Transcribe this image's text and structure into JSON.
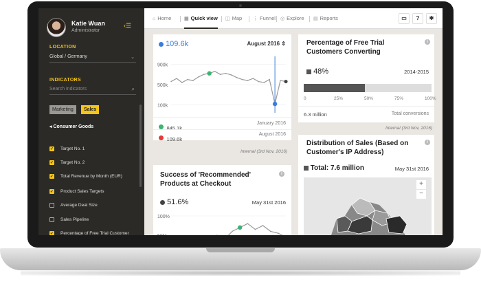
{
  "sidebar": {
    "user_name": "Katie Wuan",
    "user_role": "Administrator",
    "location_heading": "LOCATION",
    "location_value": "Global / Germany",
    "indicators_heading": "INDICATORS",
    "search_placeholder": "Search indicators",
    "tabs": [
      "Marketing",
      "Sales"
    ],
    "active_tab": "Sales",
    "group_title": "Consumer Goods",
    "indicators": [
      {
        "label": "Target No. 1",
        "checked": true
      },
      {
        "label": "Target No. 2",
        "checked": true
      },
      {
        "label": "Total Revenue by Month (EUR)",
        "checked": true
      },
      {
        "label": "Product Sales Targets",
        "checked": true
      },
      {
        "label": "Average Deal Size",
        "checked": false
      },
      {
        "label": "Sales Pipeline",
        "checked": false
      },
      {
        "label": "Percentage of Free Trial Customer Converting",
        "checked": true
      }
    ]
  },
  "nav": {
    "items": [
      {
        "label": "Home",
        "icon": "home-icon",
        "glyph": "⌂"
      },
      {
        "label": "Quick view",
        "icon": "grid-icon",
        "glyph": "▦"
      },
      {
        "label": "Map",
        "icon": "map-icon",
        "glyph": "◫"
      },
      {
        "label": "Funnel",
        "icon": "funnel-icon",
        "glyph": "⋮"
      },
      {
        "label": "Explore",
        "icon": "explore-icon",
        "glyph": "◎"
      },
      {
        "label": "Reports",
        "icon": "report-icon",
        "glyph": "▤"
      }
    ],
    "active": "Quick view",
    "right_buttons": {
      "help": "?"
    }
  },
  "line_card": {
    "value": "109.6k",
    "date_select": "August 2016",
    "y_ticks": [
      "900k",
      "500k",
      "100k"
    ],
    "legend": [
      {
        "color": "#3cb371",
        "value": "845.1k",
        "date": "January 2016"
      },
      {
        "color": "#e53935",
        "value": "109.6k",
        "date": "August 2016"
      }
    ],
    "caption": "Internal (3rd Nov, 2016)"
  },
  "recommended_card": {
    "title": "Success of 'Recommended' Products at Checkout",
    "value": "51.6%",
    "date": "May 31st 2016",
    "y_ticks": [
      "100%",
      "50%"
    ]
  },
  "trial_card": {
    "title": "Percentage of Free Trial Customers Converting",
    "value": "48%",
    "range": "2014-2015",
    "progress": 0.48,
    "ticks": [
      "0",
      "25%",
      "50%",
      "75%",
      "100%"
    ],
    "total": "6.3 million",
    "total_label": "Total conversions",
    "caption": "Internal (3rd Nov, 2016)"
  },
  "sales_card": {
    "title": "Distribution of Sales (Based on Customer's IP Address)",
    "total": "Total: 7.6 million",
    "date": "May 31st 2016",
    "zoom_in": "+",
    "zoom_out": "−"
  },
  "chart_data": [
    {
      "type": "line",
      "ylim": [
        0,
        1000
      ],
      "y_ticks": [
        "900k",
        "500k",
        "100k"
      ],
      "values": [
        560,
        620,
        540,
        600,
        580,
        650,
        700,
        720,
        760,
        700,
        720,
        690,
        640,
        600,
        580,
        620,
        560,
        540,
        600,
        120,
        580,
        560
      ],
      "highlights": [
        {
          "index": 7,
          "color": "#3cb371"
        },
        {
          "index": 19,
          "color": "#3b7ddd"
        }
      ],
      "value_unit": "k"
    },
    {
      "type": "line",
      "ylim": [
        0,
        100
      ],
      "y_ticks": [
        "100%",
        "50%"
      ],
      "values": [
        20,
        30,
        45,
        15,
        35,
        30,
        50,
        40,
        60,
        70,
        80,
        65,
        75,
        60,
        55,
        45
      ],
      "highlights": [
        {
          "index": 9,
          "color": "#3cb371"
        }
      ]
    }
  ],
  "colors": {
    "accent": "#f4c51a",
    "sidebar": "#2b2a27",
    "blue": "#3b7ddd",
    "green": "#3cb371",
    "red": "#e53935"
  }
}
